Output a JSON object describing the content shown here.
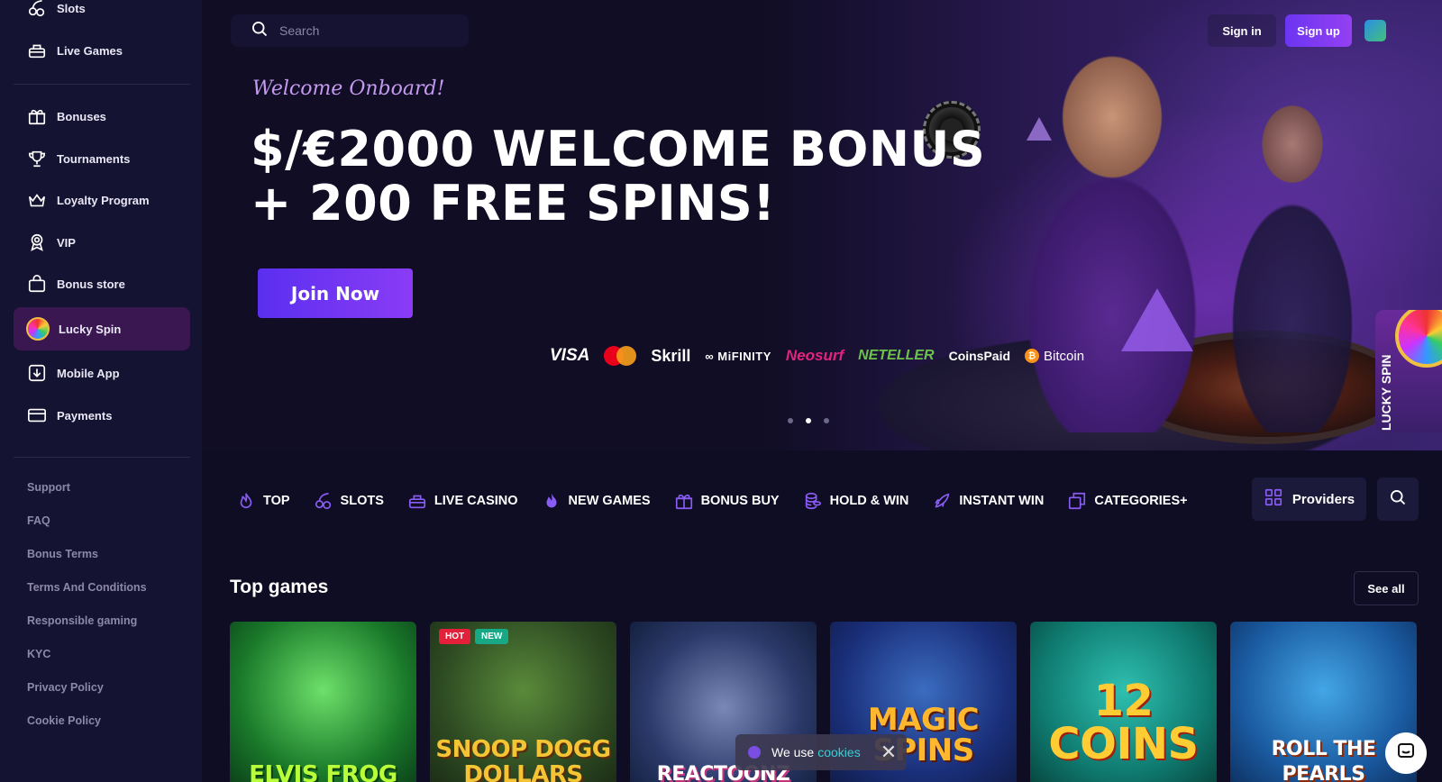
{
  "sidebar": {
    "items": [
      {
        "label": "Slots",
        "icon": "slots-icon"
      },
      {
        "label": "Live Games",
        "icon": "live-games-icon"
      },
      {
        "label": "Bonuses",
        "icon": "gift-icon"
      },
      {
        "label": "Tournaments",
        "icon": "trophy-icon"
      },
      {
        "label": "Loyalty Program",
        "icon": "crown-icon"
      },
      {
        "label": "VIP",
        "icon": "vip-badge-icon"
      },
      {
        "label": "Bonus store",
        "icon": "shopping-bag-icon"
      },
      {
        "label": "Lucky Spin",
        "icon": "wheel-icon",
        "active": true
      },
      {
        "label": "Mobile App",
        "icon": "download-icon"
      },
      {
        "label": "Payments",
        "icon": "card-icon"
      }
    ],
    "footer_links": [
      "Support",
      "FAQ",
      "Bonus Terms",
      "Terms And Conditions",
      "Responsible gaming",
      "KYC",
      "Privacy Policy",
      "Cookie Policy"
    ]
  },
  "header": {
    "search_placeholder": "Search",
    "signin_label": "Sign in",
    "signup_label": "Sign up"
  },
  "hero": {
    "welcome": "Welcome Onboard!",
    "headline_line1": "$/€2000 WELCOME BONUS",
    "headline_line2": "+ 200 FREE SPINS!",
    "cta": "Join Now",
    "payments": [
      "VISA",
      "Skrill",
      "MiFINITY",
      "Neosurf",
      "NETELLER",
      "CoinsPaid",
      "Bitcoin"
    ],
    "slide_count": 3,
    "active_slide": 2,
    "lucky_spin_tab": "LUCKY SPIN"
  },
  "categories": [
    {
      "label": "TOP",
      "icon": "flame-icon"
    },
    {
      "label": "SLOTS",
      "icon": "cherries-icon"
    },
    {
      "label": "LIVE CASINO",
      "icon": "live-casino-icon"
    },
    {
      "label": "NEW GAMES",
      "icon": "fire-icon"
    },
    {
      "label": "BONUS BUY",
      "icon": "gift-icon"
    },
    {
      "label": "HOLD & WIN",
      "icon": "coins-icon"
    },
    {
      "label": "INSTANT WIN",
      "icon": "rocket-icon"
    },
    {
      "label": "CATEGORIES+",
      "icon": "layers-icon"
    }
  ],
  "providers_label": "Providers",
  "top_games": {
    "title": "Top games",
    "see_all": "See all",
    "games": [
      {
        "name": "ELVIS FROG",
        "badges": []
      },
      {
        "name": "SNOOP DOGG DOLLARS",
        "badges": [
          "HOT",
          "NEW"
        ]
      },
      {
        "name": "REACTOONZ",
        "badges": []
      },
      {
        "name": "MAGIC SPINS",
        "badges": []
      },
      {
        "name": "12 COINS",
        "badges": []
      },
      {
        "name": "ROLL THE PEARLS",
        "badges": []
      }
    ]
  },
  "cookie_banner": {
    "text": "We use",
    "link": "cookies"
  },
  "colors": {
    "accent": "#7b3cf2",
    "sidebar_bg": "#151332",
    "page_bg": "#0f0d24",
    "active_item": "#3a1750"
  }
}
